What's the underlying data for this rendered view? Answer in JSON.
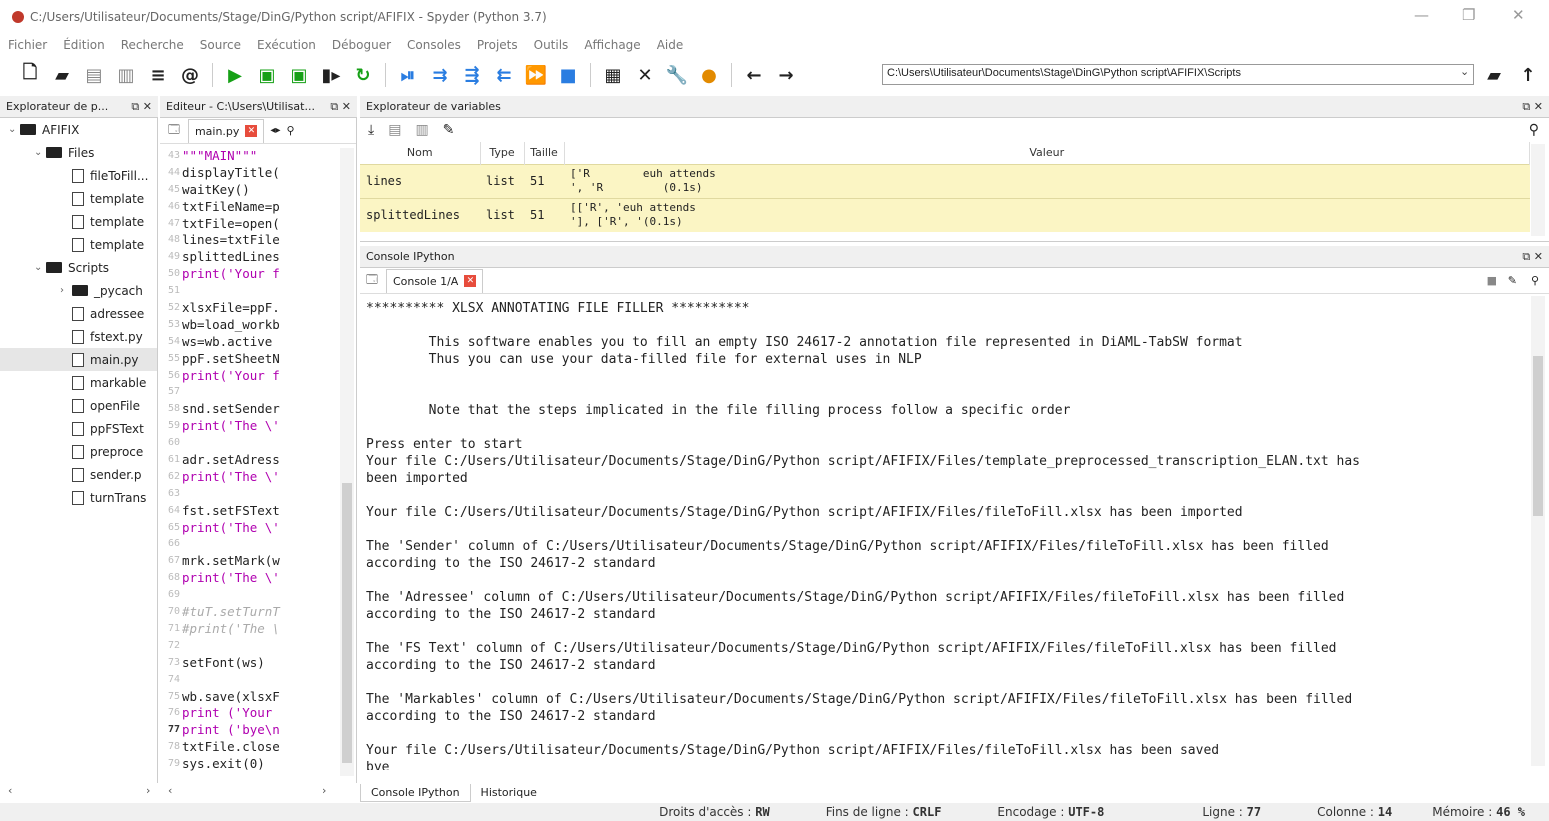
{
  "window": {
    "title": "C:/Users/Utilisateur/Documents/Stage/DinG/Python script/AFIFIX - Spyder (Python 3.7)"
  },
  "menu": [
    "Fichier",
    "Édition",
    "Recherche",
    "Source",
    "Exécution",
    "Déboguer",
    "Consoles",
    "Projets",
    "Outils",
    "Affichage",
    "Aide"
  ],
  "toolbar": {
    "path": "C:\\Users\\Utilisateur\\Documents\\Stage\\DinG\\Python script\\AFIFIX\\Scripts",
    "icons": [
      "new-file",
      "open-folder",
      "save",
      "save-all",
      "list",
      "at",
      "run",
      "run-cell",
      "run-cell-advance",
      "run-selection",
      "rerun",
      "debug",
      "step",
      "step-into",
      "step-return",
      "continue",
      "stop",
      "maximize",
      "fullscreen",
      "preferences",
      "python-path",
      "back",
      "forward",
      "browse",
      "go-parent"
    ]
  },
  "explorer": {
    "title": "Explorateur de p...",
    "items": [
      {
        "label": "AFIFIX",
        "type": "folder",
        "depth": 0,
        "arrow": "v"
      },
      {
        "label": "Files",
        "type": "folder",
        "depth": 1,
        "arrow": "v"
      },
      {
        "label": "fileToFill...",
        "type": "file",
        "depth": 2
      },
      {
        "label": "template",
        "type": "file",
        "depth": 2
      },
      {
        "label": "template",
        "type": "file",
        "depth": 2
      },
      {
        "label": "template",
        "type": "file",
        "depth": 2
      },
      {
        "label": "Scripts",
        "type": "folder",
        "depth": 1,
        "arrow": "v"
      },
      {
        "label": "_pycach",
        "type": "folder",
        "depth": 2,
        "arrow": ">"
      },
      {
        "label": "adressee",
        "type": "file",
        "depth": 2
      },
      {
        "label": "fstext.py",
        "type": "file",
        "depth": 2
      },
      {
        "label": "main.py",
        "type": "file",
        "depth": 2,
        "selected": true
      },
      {
        "label": "markable",
        "type": "file",
        "depth": 2
      },
      {
        "label": "openFile",
        "type": "file",
        "depth": 2
      },
      {
        "label": "ppFSText",
        "type": "file",
        "depth": 2
      },
      {
        "label": "preproce",
        "type": "file",
        "depth": 2
      },
      {
        "label": "sender.p",
        "type": "file",
        "depth": 2
      },
      {
        "label": "turnTrans",
        "type": "file",
        "depth": 2
      }
    ]
  },
  "editor": {
    "title": "Editeur - C:\\Users\\Utilisat...",
    "tab": "main.py",
    "lines": [
      {
        "n": "43",
        "t": "\"\"\"MAIN\"\"\"",
        "k": "str"
      },
      {
        "n": "44",
        "t": "displayTitle(",
        "k": ""
      },
      {
        "n": "45",
        "t": "waitKey()",
        "k": ""
      },
      {
        "n": "46",
        "t": "txtFileName=p",
        "k": ""
      },
      {
        "n": "47",
        "t": "txtFile=open(",
        "k": ""
      },
      {
        "n": "48",
        "t": "lines=txtFile",
        "k": ""
      },
      {
        "n": "49",
        "t": "splittedLines",
        "k": ""
      },
      {
        "n": "50",
        "t": "print('Your f",
        "k": "str"
      },
      {
        "n": "51",
        "t": "",
        "k": ""
      },
      {
        "n": "52",
        "t": "xlsxFile=ppF.",
        "k": ""
      },
      {
        "n": "53",
        "t": "wb=load_workb",
        "k": ""
      },
      {
        "n": "54",
        "t": "ws=wb.active",
        "k": ""
      },
      {
        "n": "55",
        "t": "ppF.setSheetN",
        "k": ""
      },
      {
        "n": "56",
        "t": "print('Your f",
        "k": "str"
      },
      {
        "n": "57",
        "t": "",
        "k": ""
      },
      {
        "n": "58",
        "t": "snd.setSender",
        "k": ""
      },
      {
        "n": "59",
        "t": "print('The \\'",
        "k": "str"
      },
      {
        "n": "60",
        "t": "",
        "k": ""
      },
      {
        "n": "61",
        "t": "adr.setAdress",
        "k": ""
      },
      {
        "n": "62",
        "t": "print('The \\'",
        "k": "str"
      },
      {
        "n": "63",
        "t": "",
        "k": ""
      },
      {
        "n": "64",
        "t": "fst.setFSText",
        "k": ""
      },
      {
        "n": "65",
        "t": "print('The \\'",
        "k": "str"
      },
      {
        "n": "66",
        "t": "",
        "k": ""
      },
      {
        "n": "67",
        "t": "mrk.setMark(w",
        "k": ""
      },
      {
        "n": "68",
        "t": "print('The \\'",
        "k": "str"
      },
      {
        "n": "69",
        "t": "",
        "k": ""
      },
      {
        "n": "70",
        "t": "#tuT.setTurnT",
        "k": "cm"
      },
      {
        "n": "71",
        "t": "#print('The \\",
        "k": "cm"
      },
      {
        "n": "72",
        "t": "",
        "k": ""
      },
      {
        "n": "73",
        "t": "setFont(ws)",
        "k": ""
      },
      {
        "n": "74",
        "t": "",
        "k": ""
      },
      {
        "n": "75",
        "t": "wb.save(xlsxF",
        "k": ""
      },
      {
        "n": "76",
        "t": "print ('Your",
        "k": "str"
      },
      {
        "n": "77",
        "t": "print ('bye\\n",
        "k": "str",
        "cur": true
      },
      {
        "n": "78",
        "t": "txtFile.close",
        "k": ""
      },
      {
        "n": "79",
        "t": "sys.exit(0)",
        "k": ""
      }
    ]
  },
  "variables": {
    "title": "Explorateur de variables",
    "columns": [
      "Nom",
      "Type",
      "Taille",
      "Valeur"
    ],
    "rows": [
      {
        "name": "lines",
        "type": "list",
        "size": "51",
        "value": "['R        euh attends\n', 'R         (0.1s)"
      },
      {
        "name": "splittedLines",
        "type": "list",
        "size": "51",
        "value": "[['R', 'euh attends\n'], ['R', '(0.1s)"
      }
    ]
  },
  "console": {
    "title": "Console IPython",
    "tab": "Console 1/A",
    "text": "********** XLSX ANNOTATING FILE FILLER **********\n\n        This software enables you to fill an empty ISO 24617-2 annotation file represented in DiAML-TabSW format\n        Thus you can use your data-filled file for external uses in NLP\n\n\n        Note that the steps implicated in the file filling process follow a specific order\n\nPress enter to start\nYour file C:/Users/Utilisateur/Documents/Stage/DinG/Python script/AFIFIX/Files/template_preprocessed_transcription_ELAN.txt has\nbeen imported\n\nYour file C:/Users/Utilisateur/Documents/Stage/DinG/Python script/AFIFIX/Files/fileToFill.xlsx has been imported\n\nThe 'Sender' column of C:/Users/Utilisateur/Documents/Stage/DinG/Python script/AFIFIX/Files/fileToFill.xlsx has been filled\naccording to the ISO 24617-2 standard\n\nThe 'Adressee' column of C:/Users/Utilisateur/Documents/Stage/DinG/Python script/AFIFIX/Files/fileToFill.xlsx has been filled\naccording to the ISO 24617-2 standard\n\nThe 'FS Text' column of C:/Users/Utilisateur/Documents/Stage/DinG/Python script/AFIFIX/Files/fileToFill.xlsx has been filled\naccording to the ISO 24617-2 standard\n\nThe 'Markables' column of C:/Users/Utilisateur/Documents/Stage/DinG/Python script/AFIFIX/Files/fileToFill.xlsx has been filled\naccording to the ISO 24617-2 standard\n\nYour file C:/Users/Utilisateur/Documents/Stage/DinG/Python script/AFIFIX/Files/fileToFill.xlsx has been saved\nbye"
  },
  "bottom_tabs": [
    "Console IPython",
    "Historique"
  ],
  "status": {
    "access_label": "Droits d'accès :",
    "access": "RW",
    "eol_label": "Fins de ligne :",
    "eol": "CRLF",
    "enc_label": "Encodage :",
    "enc": "UTF-8",
    "line_label": "Ligne :",
    "line": "77",
    "col_label": "Colonne :",
    "col": "14",
    "mem_label": "Mémoire :",
    "mem": "46 %"
  }
}
